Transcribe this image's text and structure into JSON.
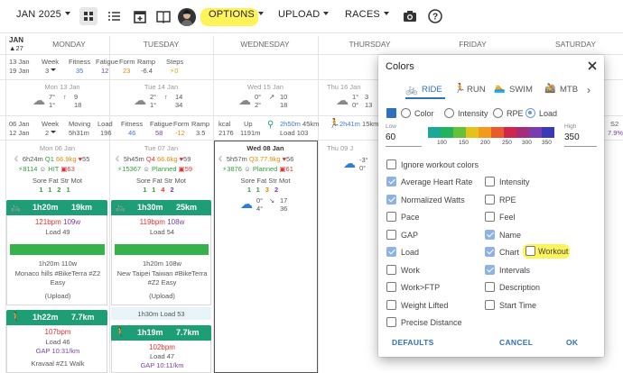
{
  "toolbar": {
    "month": "JAN 2025",
    "options": "OPTIONS",
    "upload": "UPLOAD",
    "races": "RACES"
  },
  "calendar": {
    "corner": {
      "month": "JAN",
      "week_num": "27"
    },
    "days": [
      "MONDAY",
      "TUESDAY",
      "WEDNESDAY",
      "THURSDAY",
      "FRIDAY",
      "SATURDAY"
    ],
    "week1_summary": {
      "date": "13 Jan",
      "date2": "19 Jan",
      "week_label": "Week",
      "week_num": "3",
      "fitness_label": "Fitness",
      "fatigue_label": "Fatigue",
      "form_label": "Form",
      "ramp_label": "Ramp",
      "steps_label": "Steps",
      "fitness": "35",
      "fatigue": "12",
      "form": "23",
      "ramp": "-6.4",
      "steps": "0"
    },
    "weather1": [
      {
        "date": "Mon 13 Jan",
        "t1": "7°",
        "t2": "1°",
        "w1": "9",
        "w2": "18"
      },
      {
        "date": "Tue 14 Jan",
        "t1": "2°",
        "t2": "1°",
        "w1": "14",
        "w2": "34"
      },
      {
        "date": "Wed 15 Jan",
        "t1": "0°",
        "t2": "2°",
        "w1": "10",
        "w2": "18"
      },
      {
        "date": "Thu 16 Jan",
        "t1": "1°",
        "t2": "0°",
        "w1": "3",
        "w2": "13"
      }
    ],
    "week2_summary": {
      "date": "06 Jan",
      "date2": "12 Jan",
      "week_label": "Week",
      "week_num": "2",
      "moving_label": "Moving",
      "load_label": "Load",
      "fitness_label": "Fitness",
      "fatigue_label": "Fatigue",
      "form_label": "Form",
      "ramp_label": "Ramp",
      "kcal_label": "kcal",
      "up_label": "Up",
      "moving": "5h31m",
      "load": "196",
      "fitness": "46",
      "fatigue": "58",
      "form": "-12",
      "ramp": "3.5",
      "kcal": "2176",
      "up": "1191m",
      "ride_time": "2h50m",
      "ride_dist": "45km",
      "ride_load": "Load 103",
      "run_time": "2h41m",
      "run_dist": "15km",
      "s2_label": "S2",
      "s2_val": "7.9%"
    },
    "mon": {
      "date": "Mon 06 Jan",
      "sleep": "6h24m",
      "q": "Q1",
      "weight": "66.9kg",
      "hr": "55",
      "steps": "8114",
      "hit": "HIT",
      "hrv": "63",
      "sore_label": "Sore Fat Str Mot",
      "sore": [
        "1",
        "1",
        "2",
        "1"
      ],
      "ride": {
        "time": "1h20m",
        "dist": "19km",
        "hr": "121bpm",
        "watts": "109w",
        "load": "Load 49",
        "dur": "1h20m 110w",
        "name": "Monaco hills #BikeTerra #Z2 Easy",
        "status": "(Upload)"
      },
      "walk": {
        "time": "1h22m",
        "dist": "7.7km",
        "hr": "107bpm",
        "load": "Load 46",
        "gap": "GAP 10:31/km",
        "name": "Kravaal #Z1 Walk"
      }
    },
    "tue": {
      "date": "Tue 07 Jan",
      "sleep": "5h45m",
      "q": "Q4",
      "weight": "66.6kg",
      "hr": "59",
      "steps": "15367",
      "planned": "Planned",
      "hrv": "59",
      "sore_label": "Sore Fat Str Mot",
      "sore": [
        "1",
        "1",
        "4",
        "2"
      ],
      "ride": {
        "time": "1h30m",
        "dist": "25km",
        "hr": "119bpm",
        "watts": "108w",
        "load": "Load 54",
        "dur": "1h20m 108w",
        "name": "New Taipei Taiwan #BikeTerra #Z2 Easy",
        "status": "(Upload)",
        "planned": "1h30m Load 53"
      },
      "walk": {
        "time": "1h19m",
        "dist": "7.7km",
        "hr": "102bpm",
        "load": "Load 47",
        "gap": "GAP 10:11/km"
      }
    },
    "wed": {
      "date": "Wed 08 Jan",
      "sleep": "5h57m",
      "q": "Q3",
      "weight": "77.9kg",
      "hr": "56",
      "steps": "3876",
      "planned": "Planned",
      "hrv": "61",
      "sore_label": "Sore Fat Str Mot",
      "sore": [
        "1",
        "1",
        "3",
        "2"
      ],
      "weather": {
        "t1": "0°",
        "t2": "4°",
        "w1": "17",
        "w2": "36"
      }
    },
    "thu": {
      "date": "Thu 09 J",
      "t1": "-3°",
      "t2": "0°"
    }
  },
  "dialog": {
    "title": "Colors",
    "tabs": [
      "RIDE",
      "RUN",
      "SWIM",
      "MTB"
    ],
    "modes": [
      "Color",
      "Intensity",
      "RPE",
      "Load"
    ],
    "low_label": "Low",
    "low": "60",
    "high_label": "High",
    "high": "350",
    "scale_ticks": [
      "100",
      "150",
      "200",
      "250",
      "300",
      "350"
    ],
    "scale_colors": [
      "#1aa89a",
      "#23b35a",
      "#63c23a",
      "#e3c21c",
      "#f29a1a",
      "#ea5a2a",
      "#d0264e",
      "#a82a7a",
      "#7a3ab0",
      "#3a3ab8"
    ],
    "ignore_label": "Ignore workout colors",
    "left_options": [
      {
        "label": "Average Heart Rate",
        "checked": true
      },
      {
        "label": "Normalized Watts",
        "checked": true
      },
      {
        "label": "Pace",
        "checked": false
      },
      {
        "label": "GAP",
        "checked": false
      },
      {
        "label": "Load",
        "checked": true
      },
      {
        "label": "Work",
        "checked": false
      },
      {
        "label": "Work>FTP",
        "checked": false
      },
      {
        "label": "Weight Lifted",
        "checked": false
      },
      {
        "label": "Precise Distance",
        "checked": false
      }
    ],
    "right_options": [
      {
        "label": "Intensity",
        "checked": false
      },
      {
        "label": "RPE",
        "checked": false
      },
      {
        "label": "Feel",
        "checked": false
      },
      {
        "label": "Name",
        "checked": true
      },
      {
        "label": "Chart",
        "checked": true
      },
      {
        "label": "Intervals",
        "checked": true
      },
      {
        "label": "Description",
        "checked": false
      },
      {
        "label": "Start Time",
        "checked": false
      }
    ],
    "workout_label": "Workout",
    "defaults": "DEFAULTS",
    "cancel": "CANCEL",
    "ok": "OK",
    "accent": "#2f6fbf",
    "highlight": "#fff35a"
  }
}
